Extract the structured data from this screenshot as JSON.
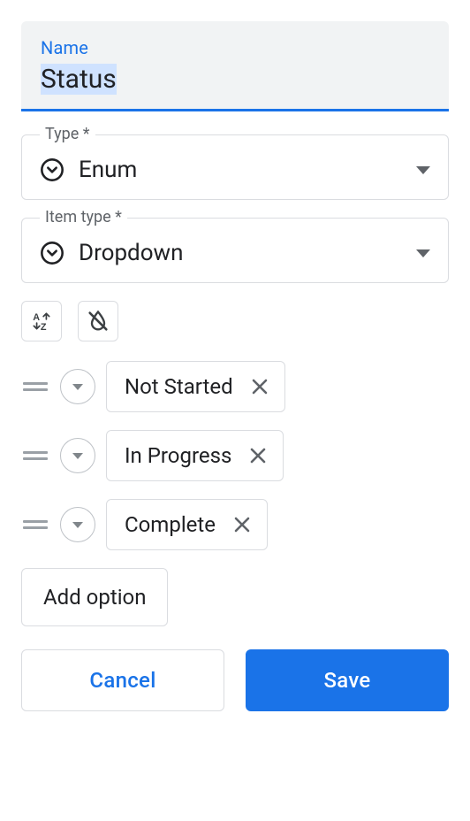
{
  "name_field": {
    "label": "Name",
    "value": "Status"
  },
  "type_field": {
    "label": "Type *",
    "value": "Enum"
  },
  "item_type_field": {
    "label": "Item type *",
    "value": "Dropdown"
  },
  "options": [
    {
      "label": "Not Started"
    },
    {
      "label": "In Progress"
    },
    {
      "label": "Complete"
    }
  ],
  "buttons": {
    "add_option": "Add option",
    "cancel": "Cancel",
    "save": "Save"
  },
  "icons": {
    "sort_az": "sort-az-icon",
    "color_off": "color-off-icon"
  }
}
